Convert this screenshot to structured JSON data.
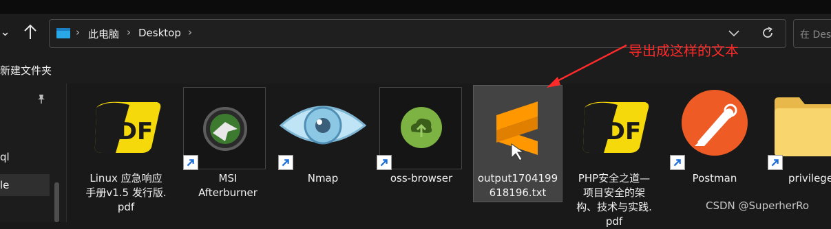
{
  "address_bar": {
    "crumbs": [
      "此电脑",
      "Desktop"
    ],
    "separator": "›",
    "search_placeholder": "在 Desktop"
  },
  "toolbar": {
    "new_folder_label": "新建文件夹"
  },
  "sidebar": {
    "items": [
      {
        "label": "ql",
        "selected": false
      },
      {
        "label": "le",
        "selected": true
      }
    ]
  },
  "files": [
    {
      "label": "Linux 应急响应\n手册v1.5 发行版.\npdf",
      "icon": "pdf-icon",
      "shortcut": false,
      "selected": false
    },
    {
      "label": "MSI\nAfterburner",
      "icon": "msi-afterburner-icon",
      "shortcut": true,
      "selected": false
    },
    {
      "label": "Nmap",
      "icon": "nmap-eye-icon",
      "shortcut": true,
      "selected": false
    },
    {
      "label": "oss-browser",
      "icon": "oss-browser-icon",
      "shortcut": true,
      "selected": false
    },
    {
      "label": "output1704199\n618196.txt",
      "icon": "sublime-text-icon",
      "shortcut": false,
      "selected": true
    },
    {
      "label": "PHP安全之道—\n项目安全的架\n构、技术与实践.\npdf",
      "icon": "pdf-icon",
      "shortcut": false,
      "selected": false
    },
    {
      "label": "Postman",
      "icon": "postman-icon",
      "shortcut": true,
      "selected": false
    },
    {
      "label": "privilege",
      "icon": "folder-icon",
      "shortcut": true,
      "selected": false
    }
  ],
  "annotation": {
    "text": "导出成这样的文本",
    "color": "#ff2a2a"
  },
  "watermark": {
    "text": "CSDN @SuperherRo"
  },
  "colors": {
    "background": "#191919",
    "pdf_yellow": "#f5d90a",
    "sublime_orange": "#ff9800",
    "postman_orange": "#ef5b25",
    "oss_green": "#7cb342",
    "folder_yellow": "#f9d56e"
  }
}
